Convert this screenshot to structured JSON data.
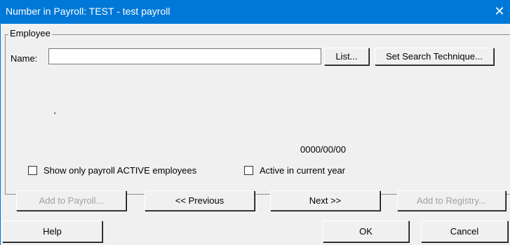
{
  "window": {
    "title": "Number in Payroll: TEST - test payroll",
    "close_glyph": "✕"
  },
  "employee_group": {
    "label": "Employee"
  },
  "name_field": {
    "label": "Name:",
    "value": ""
  },
  "buttons": {
    "list": "List...",
    "set_search": "Set Search Technique...",
    "add_to_payroll": "Add to Payroll...",
    "previous": "<< Previous",
    "next": "Next >>",
    "add_to_registry": "Add to Registry...",
    "help": "Help",
    "ok": "OK",
    "cancel": "Cancel"
  },
  "info": {
    "mark": "'",
    "date": "0000/00/00"
  },
  "checkboxes": {
    "show_active": {
      "label": "Show only payroll ACTIVE employees",
      "checked": false
    },
    "active_year": {
      "label": "Active in current year",
      "checked": false
    }
  }
}
